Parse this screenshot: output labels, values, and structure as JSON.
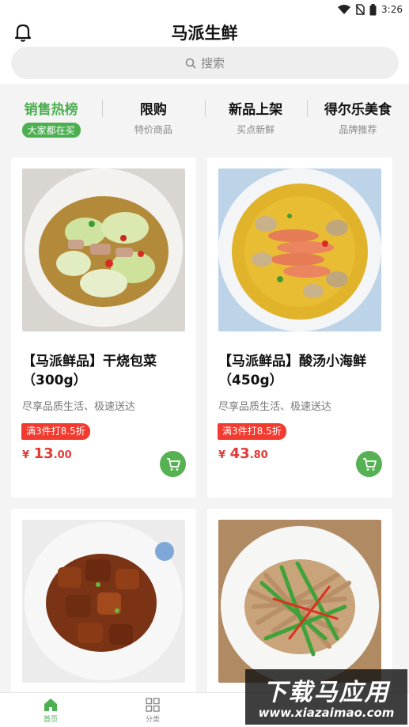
{
  "status_bar": {
    "time": "3:26"
  },
  "header": {
    "title": "马派生鲜",
    "bell_icon": "bell-icon"
  },
  "search": {
    "placeholder": "搜索",
    "icon": "search-icon"
  },
  "tabs": [
    {
      "title": "销售热榜",
      "subtitle": "大家都在买",
      "active": true
    },
    {
      "title": "限购",
      "subtitle": "特价商品"
    },
    {
      "title": "新品上架",
      "subtitle": "买点新鲜"
    },
    {
      "title": "得尔乐美食",
      "subtitle": "品牌推荐"
    }
  ],
  "products": [
    {
      "name": "【马派鲜品】干烧包菜（300g）",
      "desc": "尽享品质生活、极速送达",
      "promo": "满3件打8.5折",
      "currency": "¥",
      "price_int": "13",
      "price_dec": ".00",
      "image": "stir-fried-cabbage-photo"
    },
    {
      "name": "【马派鲜品】酸汤小海鲜（450g）",
      "desc": "尽享品质生活、极速送达",
      "promo": "满3件打8.5折",
      "currency": "¥",
      "price_int": "43",
      "price_dec": ".80",
      "image": "sour-soup-seafood-photo"
    },
    {
      "image": "braised-pork-photo"
    },
    {
      "image": "shredded-tofu-peppers-photo"
    }
  ],
  "bottom_nav": [
    {
      "label": "首页",
      "icon": "home-icon",
      "active": true
    },
    {
      "label": "分类",
      "icon": "grid-icon"
    }
  ],
  "watermark": {
    "main": "下载马应用",
    "sub": "www.xiazaimao.com"
  },
  "colors": {
    "accent": "#4caf50",
    "price": "#e53935",
    "promo": "#f23a2e"
  }
}
